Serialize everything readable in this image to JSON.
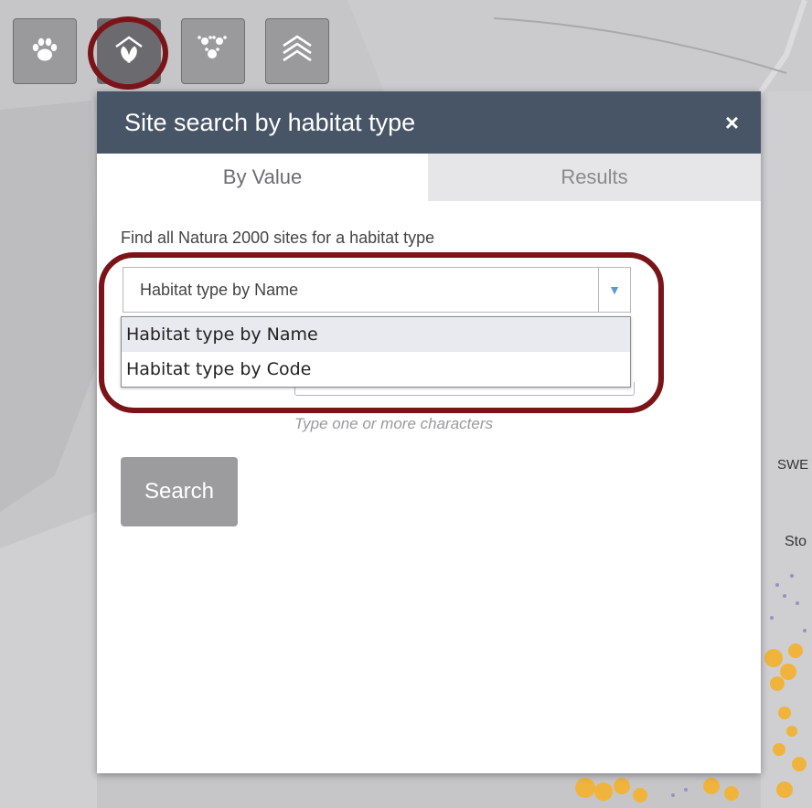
{
  "toolbar": {
    "buttons": [
      {
        "icon": "paw-icon"
      },
      {
        "icon": "habitat-icon",
        "active": true
      },
      {
        "icon": "multi-paw-icon"
      },
      {
        "icon": "layers-icon"
      }
    ]
  },
  "panel": {
    "title": "Site search by habitat type",
    "close_label": "×",
    "tabs": [
      {
        "label": "By Value",
        "active": true
      },
      {
        "label": "Results",
        "active": false
      }
    ],
    "find_label": "Find all Natura 2000 sites for a habitat type",
    "select": {
      "value": "Habitat type by Name",
      "options": [
        "Habitat type by Name",
        "Habitat type by Code"
      ],
      "selected_index": 0
    },
    "hint": "Type one or more characters",
    "search_label": "Search"
  },
  "map": {
    "labels": [
      "SWE",
      "Sto"
    ]
  },
  "colors": {
    "header_bg": "#485566",
    "highlight_ring": "#7a1418",
    "button_grey": "#9c9c9f"
  }
}
